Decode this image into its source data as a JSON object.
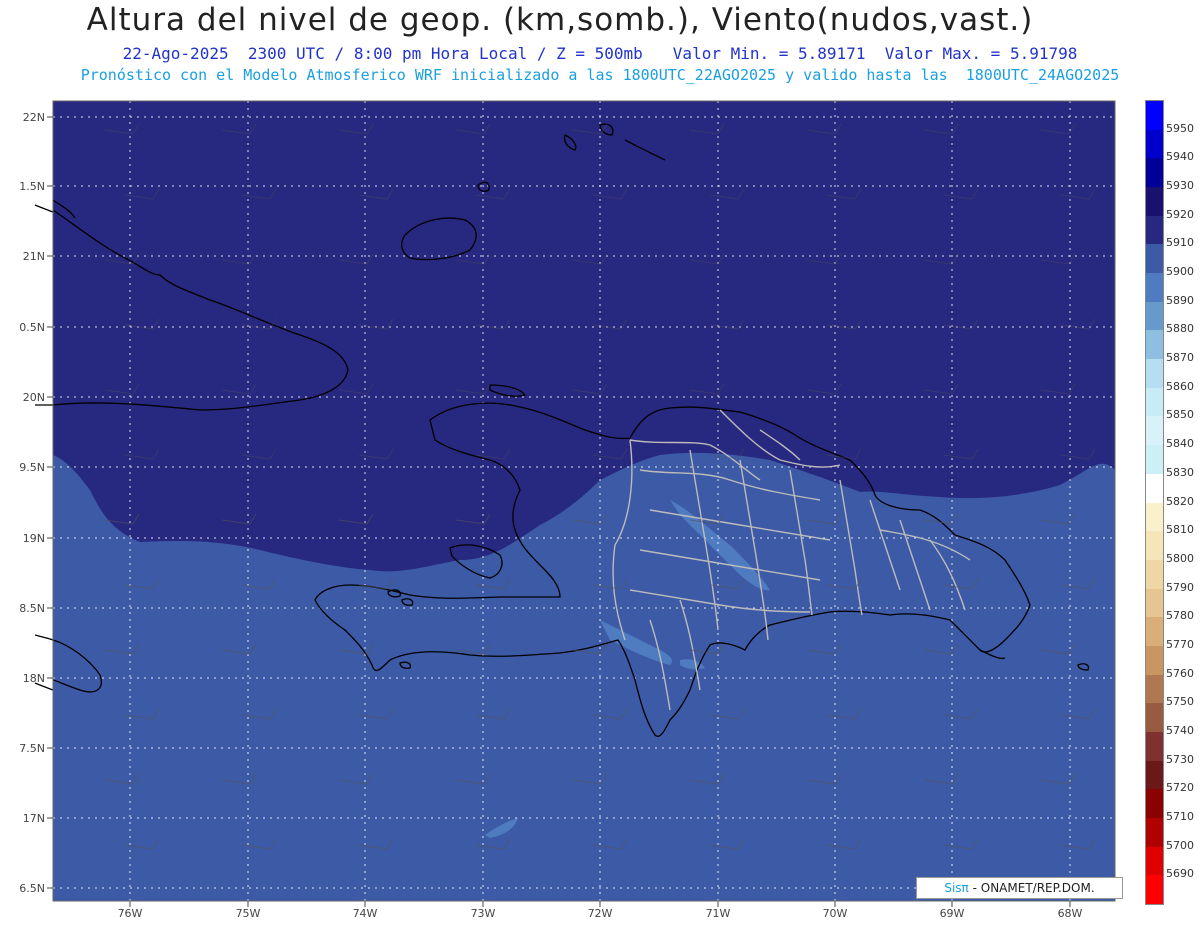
{
  "title": "Altura del nivel de geop. (km,somb.), Viento(nudos,vast.)",
  "subtitle": {
    "date_time": "22-Ago-2025  2300 UTC / 8:00 pm Hora Local / Z = 500mb",
    "min_max": "Valor Min. = 5.89171  Valor Max. = 5.91798"
  },
  "description": "Pronóstico con el Modelo Atmosferico WRF inicializado a las 1800UTC_22AGO2025 y valido hasta las  1800UTC_24AGO2025",
  "credit": {
    "brand": "Sisπ",
    "text": "- ONAMET/REP.DOM."
  },
  "map": {
    "lat_labels": [
      "22N",
      "1.5N",
      "21N",
      "0.5N",
      "20N",
      "9.5N",
      "19N",
      "8.5N",
      "18N",
      "7.5N",
      "17N",
      "6.5N"
    ],
    "lon_labels": [
      "76W",
      "75W",
      "74W",
      "73W",
      "72W",
      "71W",
      "70W",
      "69W",
      "68W"
    ],
    "fill_colors": {
      "band_5910_5920": "#27287f",
      "band_5900_5910": "#3c5aa6",
      "band_5890_5900": "#4f7bc0",
      "coastline": "#000000",
      "province_borders": "#bbbbbb"
    }
  },
  "colorbar": {
    "labels": [
      "5950",
      "5940",
      "5930",
      "5920",
      "5910",
      "5900",
      "5890",
      "5880",
      "5870",
      "5860",
      "5850",
      "5840",
      "5830",
      "5820",
      "5810",
      "5800",
      "5790",
      "5780",
      "5770",
      "5760",
      "5750",
      "5740",
      "5730",
      "5720",
      "5710",
      "5700",
      "5690"
    ],
    "colors": [
      "#0000ff",
      "#0000cc",
      "#000099",
      "#1a1070",
      "#27287f",
      "#3c5aa6",
      "#4f7bc0",
      "#6699cc",
      "#8fbfe0",
      "#b5dff0",
      "#c8ecf5",
      "#d9f2fa",
      "#cdeff6",
      "#ffffff",
      "#fbf0cc",
      "#f5e5b8",
      "#eed7a4",
      "#e6c690",
      "#d9ae78",
      "#c89660",
      "#b07850",
      "#985a40",
      "#7f3030",
      "#6a1818",
      "#8b0000",
      "#b00000",
      "#e00000",
      "#ff0000"
    ]
  }
}
